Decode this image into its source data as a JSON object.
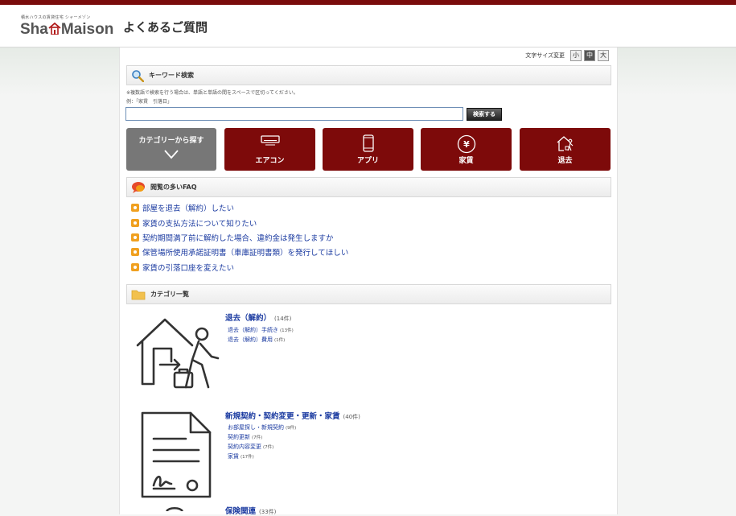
{
  "header": {
    "logo_tagline": "積水ハウスの賃貸住宅 シャーメゾン",
    "logo_left": "Sha",
    "logo_right": "Maison",
    "title": "よくあるご質問"
  },
  "font_size": {
    "label": "文字サイズ変更",
    "small": "小",
    "medium": "中",
    "large": "大",
    "active": "medium"
  },
  "search": {
    "section_title": "キーワード検索",
    "hint": "※複数語で検索を行う場合は、単語と単語の間をスペースで区切ってください。",
    "example": "例：「家賃　引落日」",
    "value": "",
    "button_label": "検索する"
  },
  "categories_nav": {
    "toggle_label": "カテゴリーから探す",
    "buttons": [
      {
        "label": "エアコン",
        "icon": "aircon-icon"
      },
      {
        "label": "アプリ",
        "icon": "smartphone-icon"
      },
      {
        "label": "家賃",
        "icon": "yen-icon"
      },
      {
        "label": "退去",
        "icon": "move-out-icon"
      }
    ]
  },
  "popular_faq": {
    "section_title": "閲覧の多いFAQ",
    "items": [
      "部屋を退去（解約）したい",
      "家賃の支払方法について知りたい",
      "契約期間満了前に解約した場合、違約金は発生しますか",
      "保管場所使用承諾証明書（車庫証明書類）を発行してほしい",
      "家賃の引落口座を変えたい"
    ]
  },
  "category_list": {
    "section_title": "カテゴリ一覧",
    "categories": [
      {
        "title": "退去（解約）",
        "count": "(14件)",
        "icon": "move-out-icon",
        "links": [
          {
            "label": "退去（解約）手続き",
            "count": "(13件)"
          },
          {
            "label": "退去（解約）費用",
            "count": "(1件)"
          }
        ]
      },
      {
        "title": "新規契約・契約変更・更新・家賃",
        "count": "(40件)",
        "icon": "contract-document-icon",
        "links": [
          {
            "label": "お部屋探し・新規契約",
            "count": "(9件)"
          },
          {
            "label": "契約更新",
            "count": "(7件)"
          },
          {
            "label": "契約内容変更",
            "count": "(7件)"
          },
          {
            "label": "家賃",
            "count": "(17件)"
          }
        ]
      },
      {
        "title": "保険関連",
        "count": "(33件)",
        "icon": "insurance-icon",
        "links": []
      }
    ]
  },
  "colors": {
    "brand_red": "#7d0a0a",
    "link_blue": "#1a3aa0",
    "top_bar": "#7a0c0c",
    "faq_bullet": "#f0a020"
  }
}
